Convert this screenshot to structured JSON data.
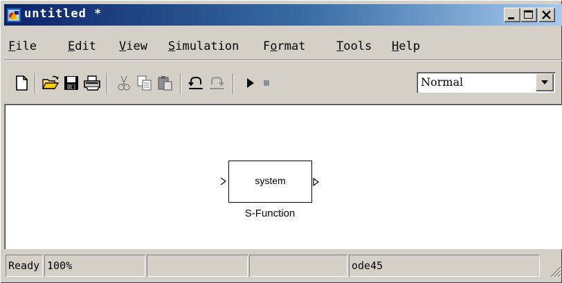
{
  "window": {
    "title": "untitled *"
  },
  "menubar": {
    "items": [
      {
        "mnemonic": "F",
        "rest": "ile"
      },
      {
        "mnemonic": "E",
        "rest": "dit"
      },
      {
        "mnemonic": "V",
        "rest": "iew"
      },
      {
        "mnemonic": "S",
        "rest": "imulation"
      },
      {
        "pre": "F",
        "mnemonic": "o",
        "rest": "rmat"
      },
      {
        "mnemonic": "T",
        "rest": "ools"
      },
      {
        "mnemonic": "H",
        "rest": "elp"
      }
    ]
  },
  "toolbar": {
    "icons": [
      "new-icon",
      "open-icon",
      "save-icon",
      "print-icon",
      "cut-icon",
      "copy-icon",
      "paste-icon",
      "undo-icon",
      "redo-icon",
      "start-simulation-icon",
      "stop-simulation-icon"
    ],
    "mode": "Normal"
  },
  "canvas": {
    "block": {
      "label": "system",
      "name": "S-Function"
    }
  },
  "statusbar": {
    "status": "Ready",
    "zoom": "100%",
    "field3": "",
    "field4": "",
    "solver": "ode45"
  },
  "colors": {
    "title_gradient_start": "#0a246a",
    "title_gradient_end": "#a6caf0",
    "face": "#d4d0c8",
    "canvas": "#ffffff"
  }
}
